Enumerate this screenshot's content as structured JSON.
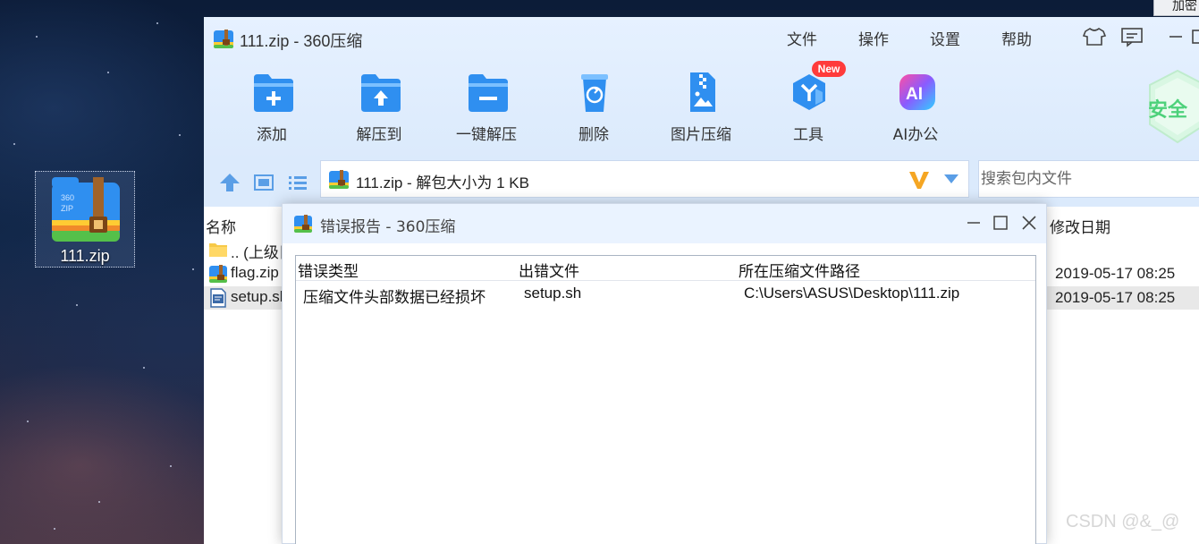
{
  "desktop": {
    "icon_label": "111.zip",
    "corner_button": "加密"
  },
  "window": {
    "title": "111.zip - 360压缩",
    "menu": [
      "文件",
      "操作",
      "设置",
      "帮助"
    ],
    "safe_badge": "安全",
    "toolbar": [
      {
        "label": "添加",
        "icon": "add-folder-icon"
      },
      {
        "label": "解压到",
        "icon": "extract-to-icon"
      },
      {
        "label": "一键解压",
        "icon": "one-click-extract-icon"
      },
      {
        "label": "删除",
        "icon": "delete-icon"
      },
      {
        "label": "图片压缩",
        "icon": "image-compress-icon"
      },
      {
        "label": "工具",
        "icon": "tools-icon"
      },
      {
        "label": "AI办公",
        "icon": "ai-office-icon"
      }
    ],
    "new_badge": "New",
    "address": "111.zip - 解包大小为 1 KB",
    "search_placeholder": "搜索包内文件",
    "columns": {
      "name": "名称",
      "modified": "修改日期"
    },
    "files": [
      {
        "name": ".. (上级目录)",
        "date": "",
        "icon": "folder-up-icon"
      },
      {
        "name": "flag.zip",
        "date": "2019-05-17 08:25",
        "icon": "zip-file-icon"
      },
      {
        "name": "setup.sh",
        "date": "2019-05-17 08:25",
        "icon": "script-file-icon"
      }
    ]
  },
  "dialog": {
    "title": "错误报告 - 360压缩",
    "columns": [
      "错误类型",
      "出错文件",
      "所在压缩文件路径"
    ],
    "rows": [
      {
        "type": "压缩文件头部数据已经损坏",
        "file": "setup.sh",
        "path": "C:\\Users\\ASUS\\Desktop\\111.zip"
      }
    ]
  },
  "watermark": "CSDN @&_@",
  "colors": {
    "accent_blue": "#2f8ff0",
    "titlebar_bg": "#dbeafc",
    "new_badge": "#ff3b3b",
    "safe_green": "#4cd17a",
    "v_orange": "#f5a623"
  }
}
